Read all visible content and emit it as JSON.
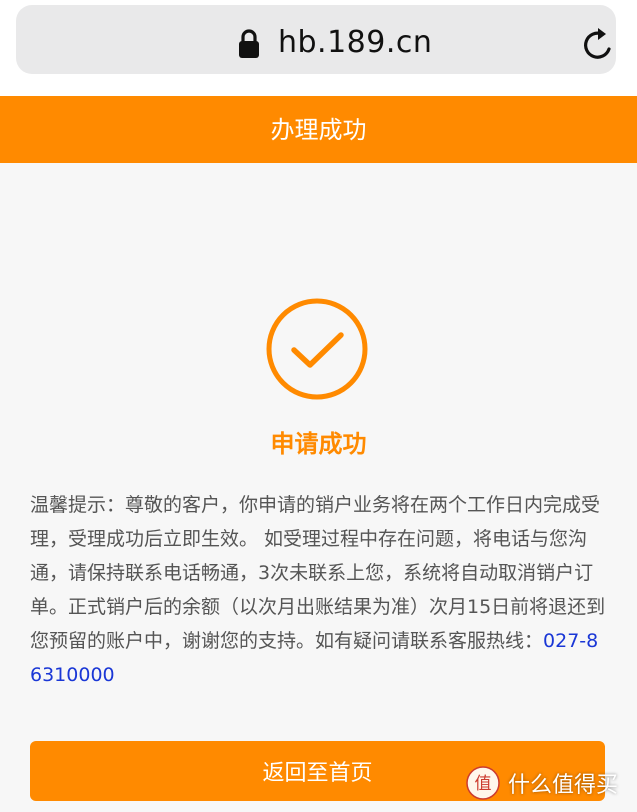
{
  "browser": {
    "url": "hb.189.cn",
    "lock_icon": "lock-icon",
    "reload_icon": "reload-icon"
  },
  "header": {
    "title": "办理成功",
    "color": "#ff8a00"
  },
  "result": {
    "icon": "check-circle-icon",
    "title": "申请成功"
  },
  "notice": {
    "text": "温馨提示：尊敬的客户，你申请的销户业务将在两个工作日内完成受理，受理成功后立即生效。 如受理过程中存在问题，将电话与您沟通，请保持联系电话畅通，3次未联系上您，系统将自动取消销户订单。正式销户后的余额（以次月出账结果为准）次月15日前将退还到您预留的账户中，谢谢您的支持。如有疑问请联系客服热线：",
    "hotline": "027-86310000",
    "hotline_color": "#1a37d6"
  },
  "actions": {
    "home_label": "返回至首页"
  },
  "watermark": {
    "logo_text": "值",
    "text": "什么值得买"
  }
}
